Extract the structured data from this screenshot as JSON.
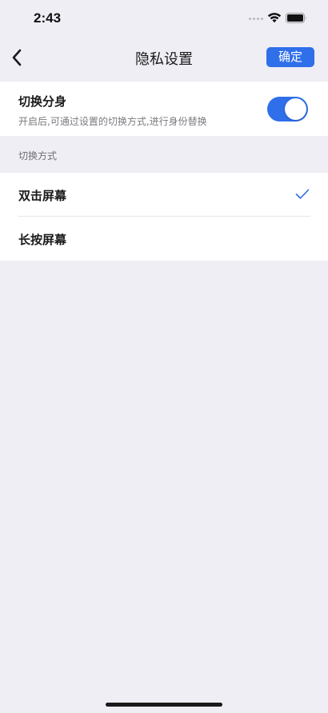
{
  "status_bar": {
    "time": "2:43",
    "icons": [
      "signal-dots-icon",
      "wifi-icon",
      "battery-icon"
    ]
  },
  "nav": {
    "back_icon": "chevron-left-icon",
    "title": "隐私设置",
    "confirm_label": "确定"
  },
  "identity_switch": {
    "title": "切换分身",
    "description": "开启后,可通过设置的切换方式,进行身份替换",
    "enabled": true
  },
  "switch_mode": {
    "section_title": "切换方式",
    "options": [
      {
        "label": "双击屏幕",
        "selected": true
      },
      {
        "label": "长按屏幕",
        "selected": false
      }
    ]
  },
  "colors": {
    "accent": "#2f6fea",
    "background": "#efeef4",
    "card": "#ffffff",
    "secondary_text": "#7a7a80"
  }
}
